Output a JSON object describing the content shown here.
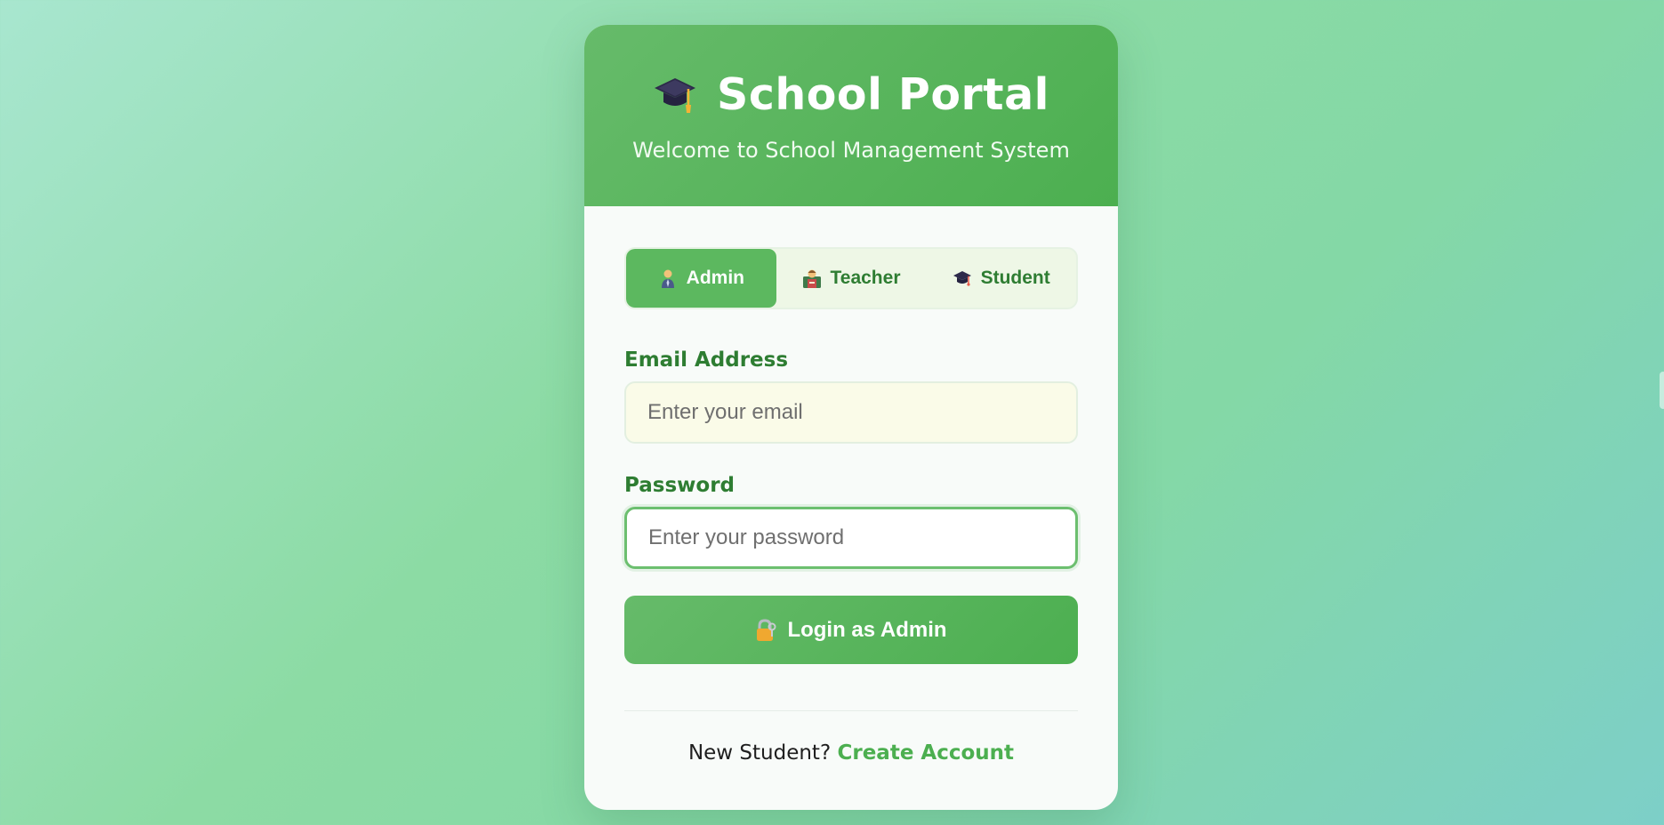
{
  "header": {
    "title": "School Portal",
    "subtitle": "Welcome to School Management System",
    "icon": "graduation-cap-icon"
  },
  "role_tabs": [
    {
      "label": "Admin",
      "icon": "admin-person-icon",
      "active": true
    },
    {
      "label": "Teacher",
      "icon": "teacher-icon",
      "active": false
    },
    {
      "label": "Student",
      "icon": "graduation-cap-icon",
      "active": false
    }
  ],
  "form": {
    "email_label": "Email Address",
    "email_placeholder": "Enter your email",
    "email_value": "",
    "password_label": "Password",
    "password_placeholder": "Enter your password",
    "password_value": "",
    "submit_label": "Login as Admin",
    "submit_icon": "lock-key-icon"
  },
  "footer": {
    "prompt": "New Student?",
    "link_label": "Create Account"
  },
  "colors": {
    "primary": "#4caf50",
    "primary_light": "#66bb6a",
    "label_green": "#2e7d32",
    "background_start": "#a8e6cf",
    "background_end": "#7dcfc8"
  }
}
